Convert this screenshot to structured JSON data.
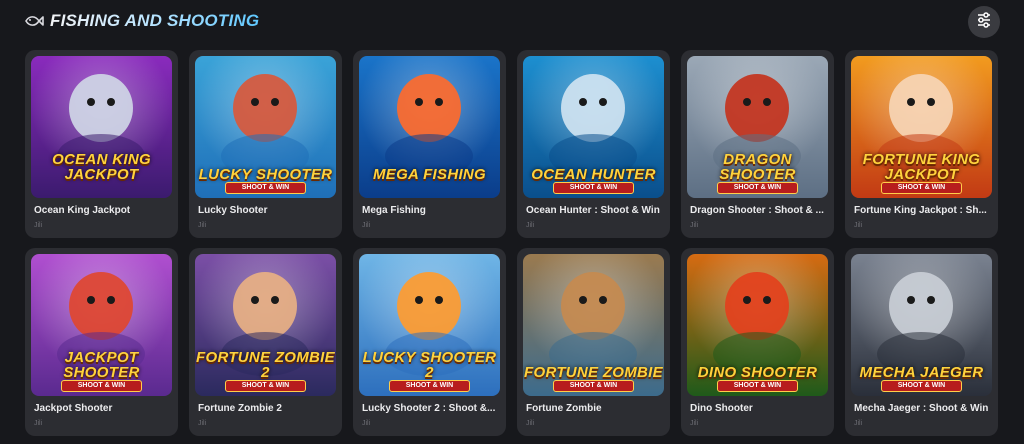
{
  "section": {
    "title": "FISHING AND SHOOTING",
    "icon": "fish-icon",
    "filter_icon": "sliders-icon"
  },
  "games": [
    {
      "title": "Ocean King Jackpot",
      "provider": "Jili",
      "logo": "Ocean King Jackpot",
      "badge": "",
      "bg1": "#3b1b6e",
      "bg2": "#8a2bbd",
      "accent": "#cfd6e6"
    },
    {
      "title": "Lucky Shooter",
      "provider": "Jili",
      "logo": "Lucky Shooter",
      "badge": "SHOOT & WIN",
      "bg1": "#1f6fb8",
      "bg2": "#3aa3d8",
      "accent": "#d9583b"
    },
    {
      "title": "Mega Fishing",
      "provider": "Jili",
      "logo": "Mega Fishing",
      "badge": "",
      "bg1": "#0b3d8a",
      "bg2": "#1a74c9",
      "accent": "#ff6a2b"
    },
    {
      "title": "Ocean Hunter : Shoot & Win",
      "provider": "Jili",
      "logo": "Ocean Hunter",
      "badge": "SHOOT & WIN",
      "bg1": "#0a4f8c",
      "bg2": "#1d8fd0",
      "accent": "#cfe3f1"
    },
    {
      "title": "Dragon Shooter : Shoot & ...",
      "provider": "Jili",
      "logo": "Dragon Shooter",
      "badge": "SHOOT & WIN",
      "bg1": "#5d6f84",
      "bg2": "#9ba8b6",
      "accent": "#c4331d"
    },
    {
      "title": "Fortune King Jackpot : Sh...",
      "provider": "Jili",
      "logo": "Fortune King Jackpot",
      "badge": "SHOOT & WIN",
      "bg1": "#c23a14",
      "bg2": "#f29b1f",
      "accent": "#f6d5b5"
    },
    {
      "title": "Jackpot Shooter",
      "provider": "Jili",
      "logo": "Jackpot Shooter",
      "badge": "SHOOT & WIN",
      "bg1": "#5a2a8f",
      "bg2": "#b04fd0",
      "accent": "#e0462f"
    },
    {
      "title": "Fortune Zombie 2",
      "provider": "Jili",
      "logo": "Fortune Zombie 2",
      "badge": "SHOOT & WIN",
      "bg1": "#2b2a5e",
      "bg2": "#7b4fa6",
      "accent": "#e8b083"
    },
    {
      "title": "Lucky Shooter 2 : Shoot &...",
      "provider": "Jili",
      "logo": "Lucky Shooter 2",
      "badge": "SHOOT & WIN",
      "bg1": "#2d6fbd",
      "bg2": "#6fb5e6",
      "accent": "#ff9b2f"
    },
    {
      "title": "Fortune Zombie",
      "provider": "Jili",
      "logo": "Fortune Zombie",
      "badge": "SHOOT & WIN",
      "bg1": "#3c6b8c",
      "bg2": "#9a7a4f",
      "accent": "#c58a4f"
    },
    {
      "title": "Dino Shooter",
      "provider": "Jili",
      "logo": "Dino Shooter",
      "badge": "SHOOT & WIN",
      "bg1": "#1f5a1a",
      "bg2": "#d66b12",
      "accent": "#e3401c"
    },
    {
      "title": "Mecha Jaeger : Shoot & Win",
      "provider": "Jili",
      "logo": "Mecha Jaeger",
      "badge": "SHOOT & WIN",
      "bg1": "#2a2f3a",
      "bg2": "#7a8290",
      "accent": "#c9ced6"
    }
  ]
}
